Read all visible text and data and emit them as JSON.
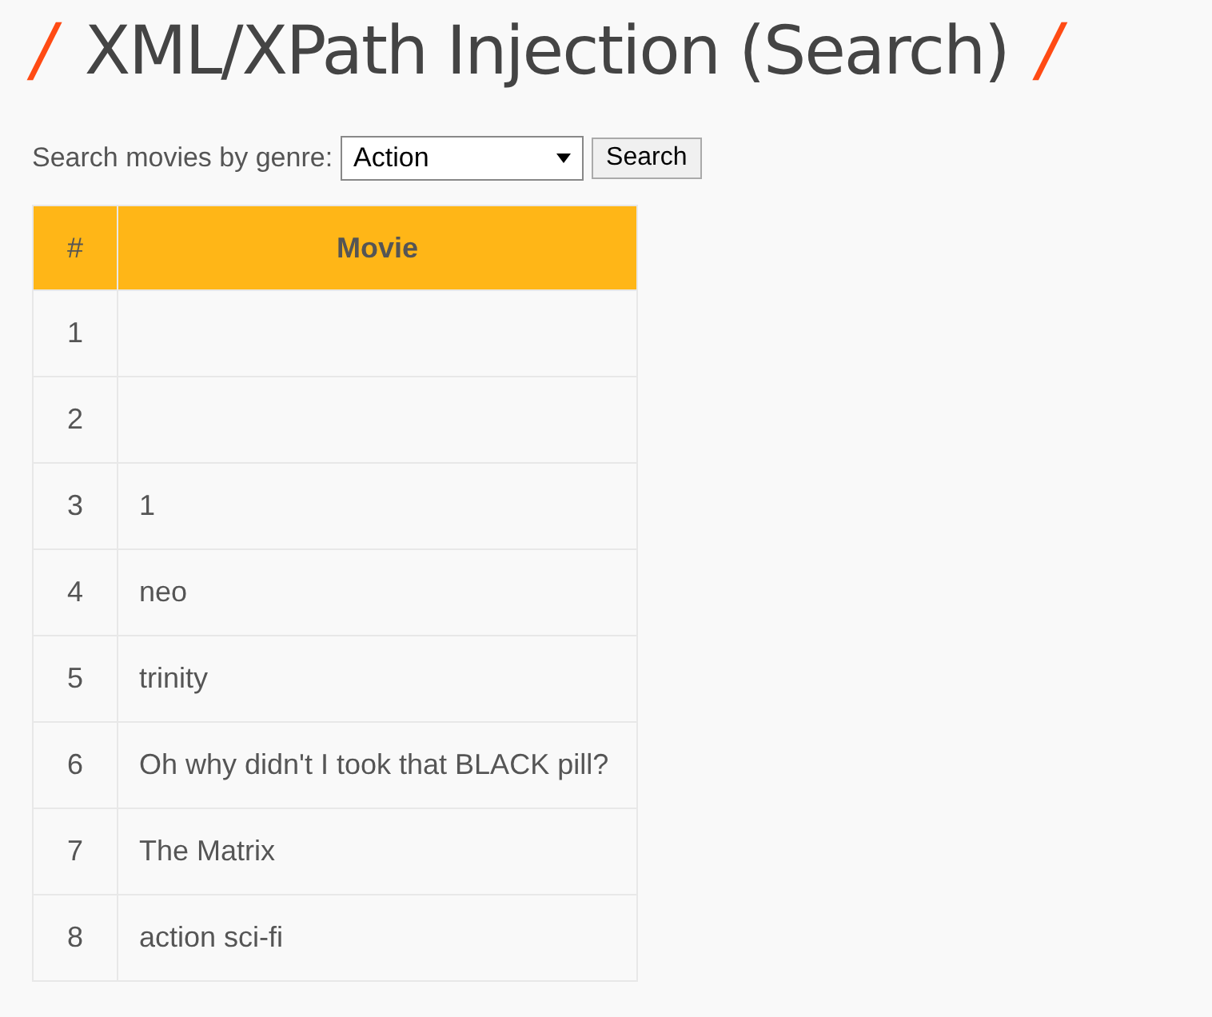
{
  "heading": {
    "mark_left": "/",
    "title": "XML/XPath Injection (Search)",
    "mark_right": "/"
  },
  "search_form": {
    "label": "Search movies by genre:",
    "genre_select": "Action",
    "button": "Search"
  },
  "table": {
    "columns": [
      "#",
      "Movie"
    ],
    "rows": [
      [
        "1",
        ""
      ],
      [
        "2",
        ""
      ],
      [
        "3",
        "1"
      ],
      [
        "4",
        "neo"
      ],
      [
        "5",
        "trinity"
      ],
      [
        "6",
        "Oh why didn't I took that BLACK pill?"
      ],
      [
        "7",
        "The Matrix"
      ],
      [
        "8",
        "action sci-fi"
      ]
    ]
  }
}
